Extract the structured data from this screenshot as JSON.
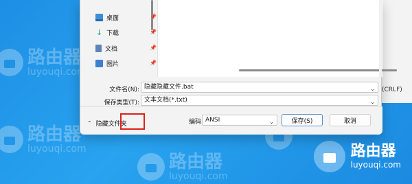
{
  "watermark": {
    "brand": "路由器",
    "site": "luyouqi.com"
  },
  "sidebar": {
    "items": [
      {
        "label": "桌面",
        "icon": "desktop-icon"
      },
      {
        "label": "下载",
        "icon": "download-icon"
      },
      {
        "label": "文档",
        "icon": "document-icon"
      },
      {
        "label": "图片",
        "icon": "picture-icon"
      }
    ]
  },
  "form": {
    "filename_label": "文件名(N):",
    "filename_value": "隐藏隐藏文件.bat",
    "type_label": "保存类型(T):",
    "type_value": "文本文档(*.txt)"
  },
  "footer": {
    "hide_folders_label": "隐藏文件夹",
    "encoding_label": "编码:",
    "encoding_value": "ANSI",
    "save_label": "保存(S)",
    "cancel_label": "取消"
  },
  "background_window": {
    "status_text": "(CRLF)"
  },
  "colors": {
    "highlight": "#e0201a",
    "desktop": "#1e8fe4"
  }
}
